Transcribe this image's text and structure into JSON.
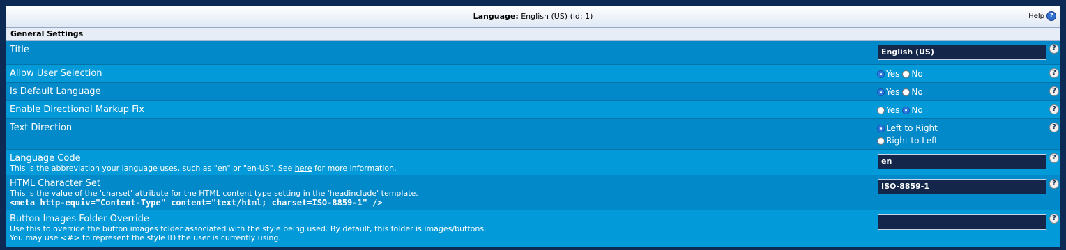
{
  "header": {
    "label": "Language:",
    "value": "English (US) (id: 1)",
    "help_label": "Help"
  },
  "section_title": "General Settings",
  "rows": {
    "title": {
      "label": "Title",
      "value": "English (US)"
    },
    "allow_user_selection": {
      "label": "Allow User Selection",
      "yes": "Yes",
      "no": "No",
      "selected": "Yes"
    },
    "is_default_language": {
      "label": "Is Default Language",
      "yes": "Yes",
      "no": "No",
      "selected": "Yes"
    },
    "enable_directional_markup_fix": {
      "label": "Enable Directional Markup Fix",
      "yes": "Yes",
      "no": "No",
      "selected": "No"
    },
    "text_direction": {
      "label": "Text Direction",
      "option1": "Left to Right",
      "option2": "Right to Left",
      "selected": "Left to Right"
    },
    "language_code": {
      "label": "Language Code",
      "desc_before": "This is the abbreviation your language uses, such as \"en\" or \"en-US\". See ",
      "desc_link": "here",
      "desc_after": " for more information.",
      "value": "en"
    },
    "html_charset": {
      "label": "HTML Character Set",
      "desc": "This is the value of the 'charset' attribute for the HTML content type setting in the 'headinclude' template.",
      "code": "<meta http-equiv=\"Content-Type\" content=\"text/html; charset=ISO-8859-1\" />",
      "value": "ISO-8859-1"
    },
    "button_images_override": {
      "label": "Button Images Folder Override",
      "desc1": "Use this to override the button images folder associated with the style being used. By default, this folder is images/buttons.",
      "desc2": "You may use <#> to represent the style ID the user is currently using.",
      "value": ""
    }
  },
  "help_icon": "question-mark-icon",
  "colors": {
    "row_dark": "#0289c9",
    "row_light": "#039ad9",
    "field_bg": "#14264a",
    "page_bg": "#0d2a55"
  }
}
